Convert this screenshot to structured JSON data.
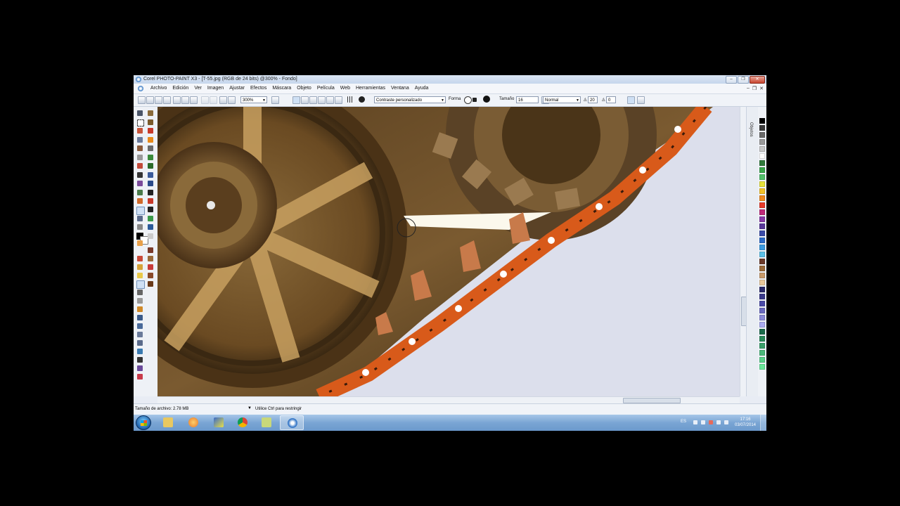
{
  "window": {
    "title": "Corel PHOTO-PAINT X3 - [T-55.jpg (RGB de 24 bits) @300% - Fondo]"
  },
  "menu": {
    "items": [
      {
        "label": "Archivo"
      },
      {
        "label": "Edición"
      },
      {
        "label": "Ver"
      },
      {
        "label": "Imagen"
      },
      {
        "label": "Ajustar"
      },
      {
        "label": "Efectos"
      },
      {
        "label": "Máscara"
      },
      {
        "label": "Objeto"
      },
      {
        "label": "Película"
      },
      {
        "label": "Web"
      },
      {
        "label": "Herramientas"
      },
      {
        "label": "Ventana"
      },
      {
        "label": "Ayuda"
      }
    ]
  },
  "toolbar": {
    "zoom_value": "300%",
    "preset_value": "Contraste personalizado",
    "shape_label": "Forma",
    "size_label": "Tamaño",
    "size_value": "16",
    "merge_mode": "Normal",
    "amount_value": "20",
    "transparency_value": "0"
  },
  "docker": {
    "tab_label": "Objetos"
  },
  "palette": {
    "colors": [
      "#000000",
      "#3a3a3a",
      "#6a6a6a",
      "#9a9a9a",
      "#c8c8c8",
      "#ffffff",
      "#2f7a3a",
      "#3aa64a",
      "#52c06a",
      "#e5e23a",
      "#f2c22a",
      "#f08a1e",
      "#e83a2a",
      "#c0287a",
      "#8a3aa8",
      "#5a3a9a",
      "#3a4aa8",
      "#2a6ac8",
      "#3a9ae0",
      "#5ac0e8",
      "#6a3a2a",
      "#9a6a3a",
      "#c89a6a",
      "#e8c89a",
      "#2a2a6a",
      "#3a3a8a",
      "#4a4aa8",
      "#6a6ac0",
      "#8a8ad8",
      "#aaaaf0",
      "#1a6a4a",
      "#2a8a5a",
      "#3aa06a",
      "#4ab87a",
      "#5ad08a",
      "#6ae89a"
    ]
  },
  "status": {
    "file_size": "Tamaño de archivo: 2.78 MB",
    "hint": "Utilice Ctrl para restringir"
  },
  "taskbar": {
    "language": "ES",
    "time": "17:16",
    "date": "03/07/2014"
  }
}
